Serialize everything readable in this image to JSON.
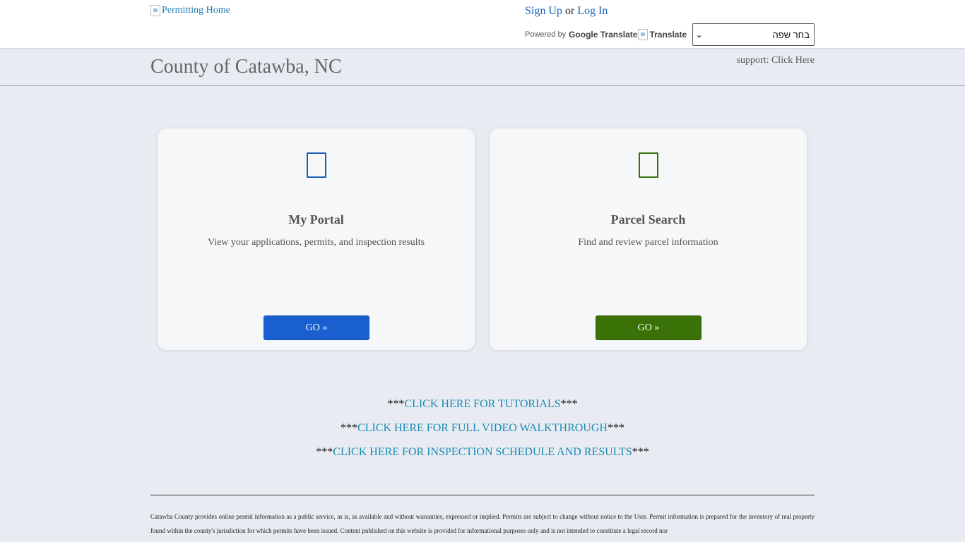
{
  "topbar": {
    "home_alt": "Permitting Home",
    "sign_up": "Sign Up",
    "or": " or ",
    "log_in": "Log In",
    "powered_by": "Powered by",
    "google_translate": "Google Translate",
    "translate": "Translate",
    "language_select": "בחר שפה"
  },
  "header": {
    "title": "County of Catawba, NC",
    "support_prefix": "support: ",
    "support_link": "Click Here"
  },
  "cards": [
    {
      "title": "My Portal",
      "description": "View your applications, permits, and inspection results",
      "button": "GO »",
      "icon": "document-icon",
      "accent": "#1a5fcf"
    },
    {
      "title": "Parcel Search",
      "description": "Find and review parcel information",
      "button": "GO »",
      "icon": "map-icon",
      "accent": "#3b7208"
    }
  ],
  "links": {
    "stars": "***",
    "tutorials": "CLICK HERE FOR TUTORIALS",
    "walkthrough": "CLICK HERE FOR FULL VIDEO WALKTHROUGH",
    "inspection": "CLICK HERE FOR INSPECTION SCHEDULE AND RESULTS"
  },
  "disclaimer": "Catawba County provides online permit information as a public service, as is, as available and without warranties, expressed or implied. Permits are subject to change without notice to the User. Permit information is prepared for the inventory of real property found within the county's jurisdiction for which permits have been issued. Content published on this website is provided for informational purposes only and is not intended to constitute a legal record nor"
}
